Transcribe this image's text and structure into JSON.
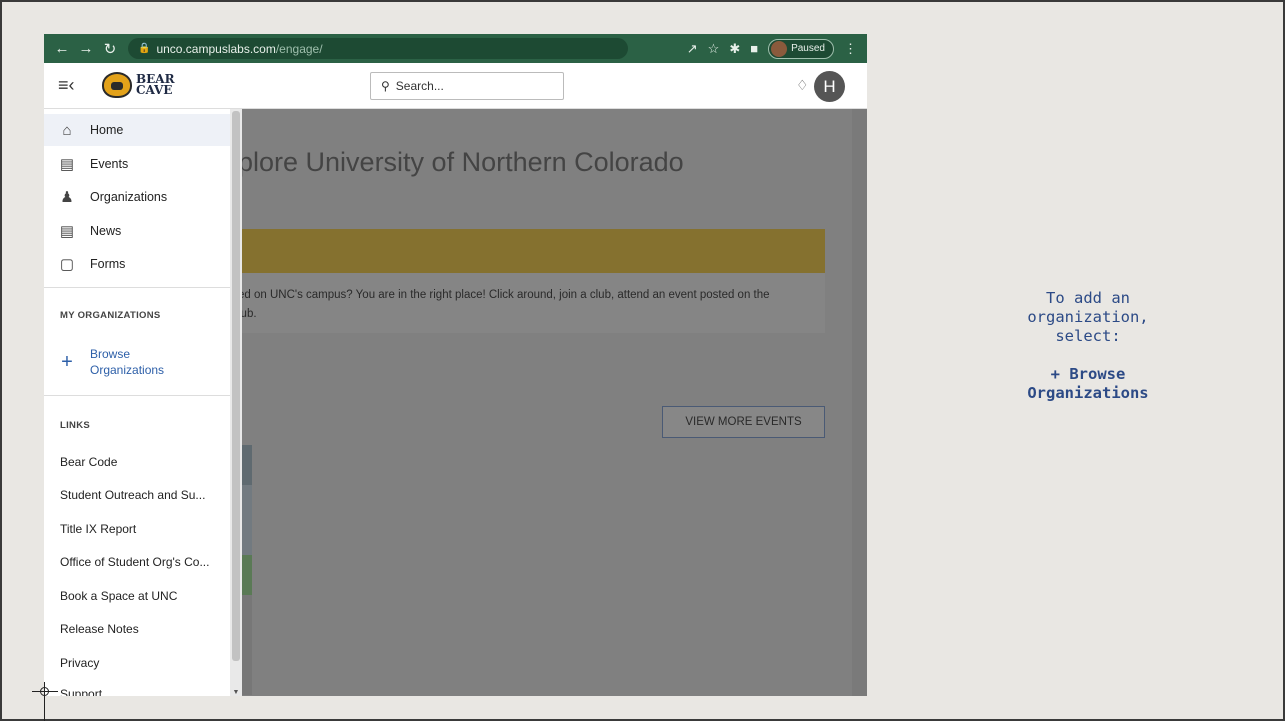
{
  "browser": {
    "url_host": "unco.campuslabs.com",
    "url_path": "/engage/",
    "profile_status": "Paused"
  },
  "header": {
    "logo_line1": "BEAR",
    "logo_line2": "CAVE",
    "search_placeholder": "Search...",
    "avatar_initial": "H"
  },
  "sidebar": {
    "nav": [
      {
        "label": "Home",
        "icon": "home-icon"
      },
      {
        "label": "Events",
        "icon": "calendar-icon"
      },
      {
        "label": "Organizations",
        "icon": "people-icon"
      },
      {
        "label": "News",
        "icon": "news-icon"
      },
      {
        "label": "Forms",
        "icon": "form-icon"
      }
    ],
    "my_orgs_heading": "MY ORGANIZATIONS",
    "browse_line1": "Browse",
    "browse_line2": "Organizations",
    "links_heading": "LINKS",
    "links": [
      "Bear Code",
      "Student Outreach and Su...",
      "Title IX Report",
      "Office of Student Org's Co...",
      "Book a Space at UNC",
      "Release Notes",
      "Privacy",
      "Support"
    ]
  },
  "main": {
    "title": "plore University of Northern Colorado",
    "intro_line1": "ed on UNC's campus? You are in the right place! Click around, join a club, attend an event posted on the",
    "intro_line2": "lub.",
    "view_more": "VIEW MORE EVENTS"
  },
  "caption": {
    "line1": "To add an",
    "line2": "organization,",
    "line3": "select:",
    "bold1": "+ Browse",
    "bold2": "Organizations"
  },
  "colors": {
    "chrome": "#2b6145",
    "accent_gold": "#85712f",
    "link_blue": "#2d5fa8",
    "caption_blue": "#2c4a86"
  }
}
